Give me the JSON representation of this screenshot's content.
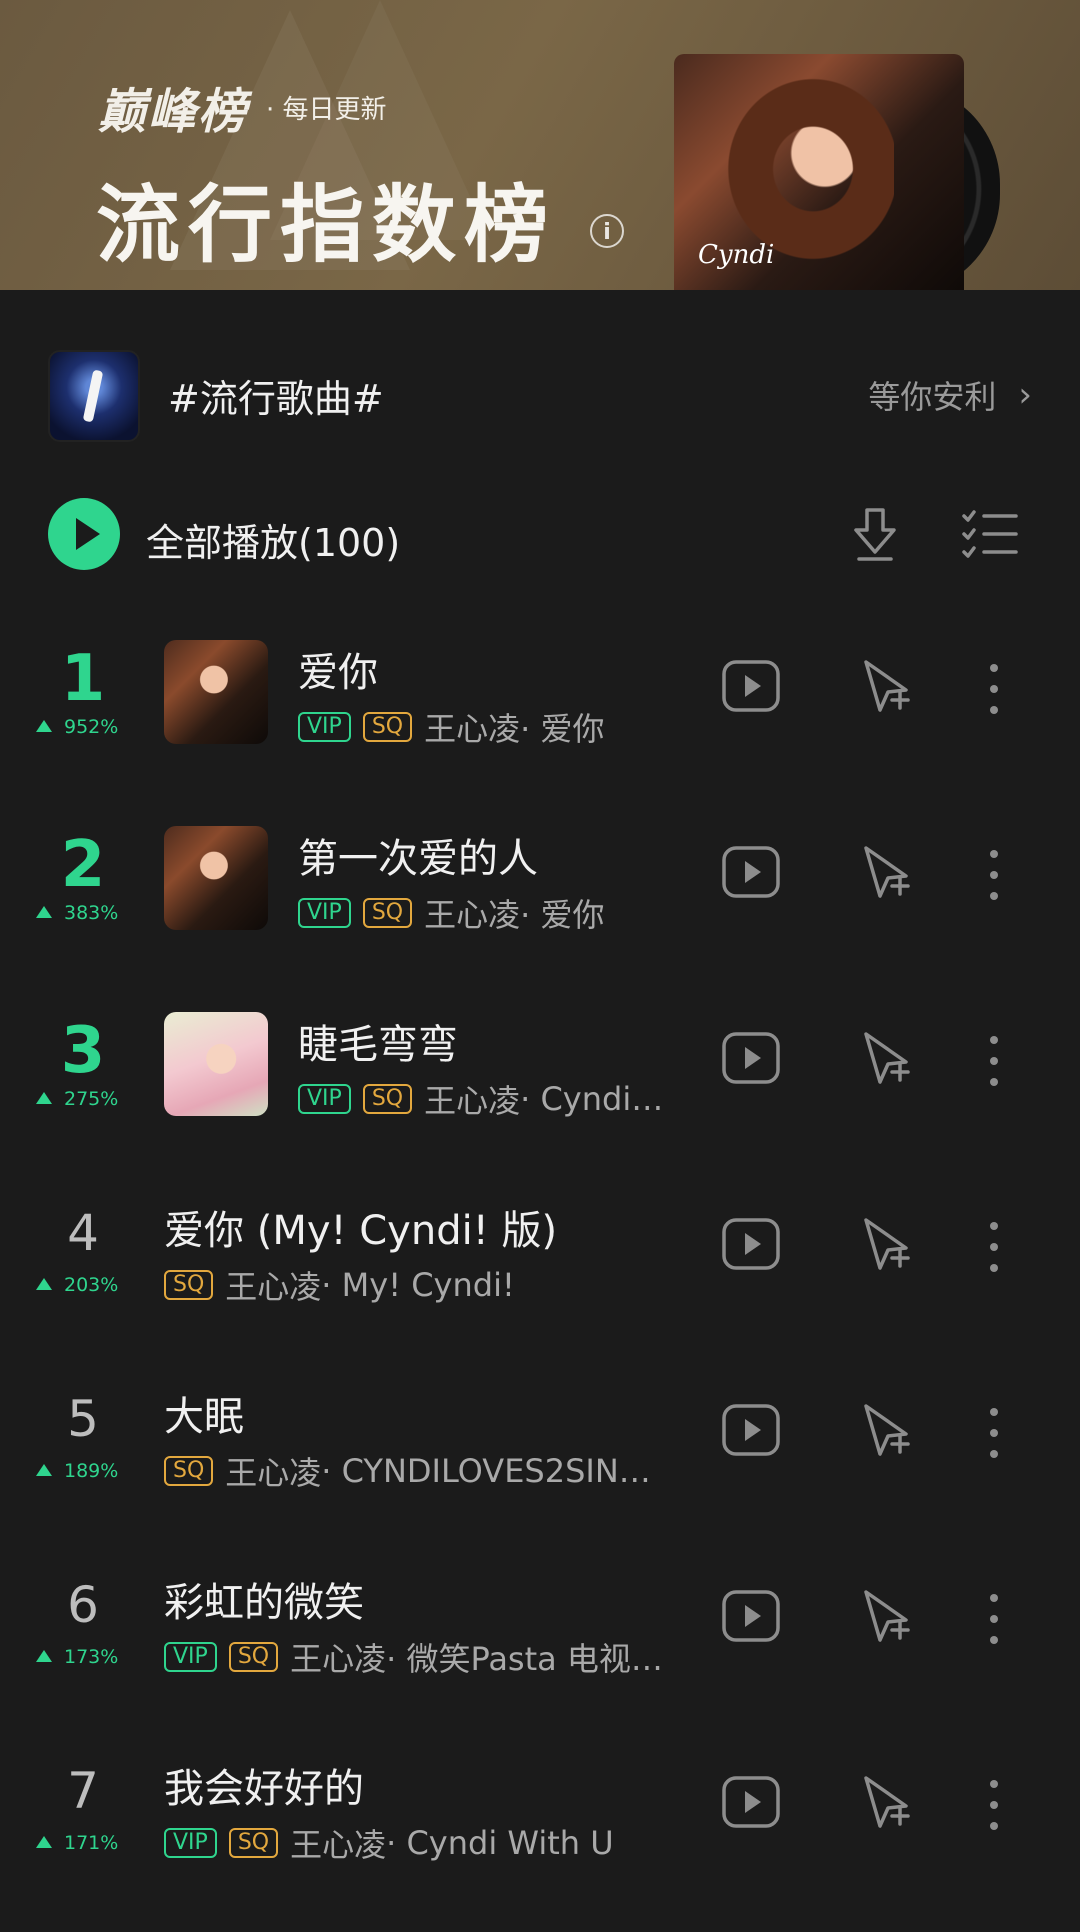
{
  "header": {
    "brand": "巅峰榜",
    "brand_sub": "· 每日更新",
    "title": "流行指数榜",
    "info_glyph": "i",
    "cover_text": "Cyndi"
  },
  "source": {
    "title": "#流行歌曲#",
    "action_label": "等你安利",
    "action_chevron": "›"
  },
  "play_all": {
    "label": "全部播放(100)"
  },
  "colors": {
    "accent": "#2fd58e",
    "sq": "#e3a83e",
    "background": "#1b1b1b"
  },
  "songs": [
    {
      "rank": "1",
      "trend": "952%",
      "title": "爱你",
      "vip": "VIP",
      "sq": "SQ",
      "artist": "王心凌",
      "album": "· 爱你"
    },
    {
      "rank": "2",
      "trend": "383%",
      "title": "第一次爱的人",
      "vip": "VIP",
      "sq": "SQ",
      "artist": "王心凌",
      "album": "· 爱你"
    },
    {
      "rank": "3",
      "trend": "275%",
      "title": "睫毛弯弯",
      "vip": "VIP",
      "sq": "SQ",
      "artist": "王心凌",
      "album": "· Cyndi…"
    },
    {
      "rank": "4",
      "trend": "203%",
      "title": "爱你 (My! Cyndi! 版)",
      "sq": "SQ",
      "artist": "王心凌",
      "album": "· My! Cyndi!"
    },
    {
      "rank": "5",
      "trend": "189%",
      "title": "大眠",
      "sq": "SQ",
      "artist": "王心凌",
      "album": "· CYNDILOVES2SIN…"
    },
    {
      "rank": "6",
      "trend": "173%",
      "title": "彩虹的微笑",
      "vip": "VIP",
      "sq": "SQ",
      "artist": "王心凌",
      "album": "· 微笑Pasta 电视…"
    },
    {
      "rank": "7",
      "trend": "171%",
      "title": "我会好好的",
      "vip": "VIP",
      "sq": "SQ",
      "artist": "王心凌",
      "album": "· Cyndi With U"
    }
  ]
}
